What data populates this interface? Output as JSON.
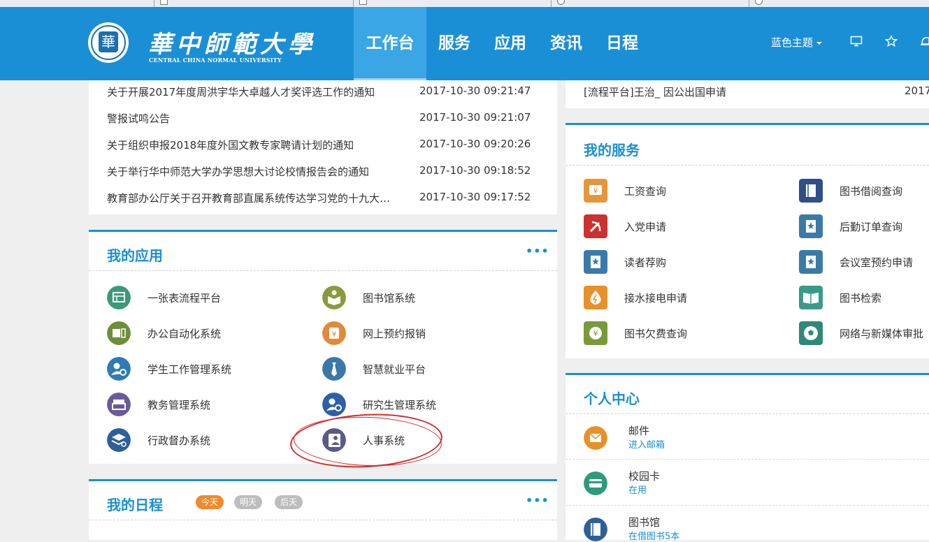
{
  "header": {
    "logo_cn": "華中師範大學",
    "logo_en": "CENTRAL CHINA NORMAL UNIVERSITY",
    "seal_char": "華",
    "nav": [
      {
        "label": "工作台",
        "active": true
      },
      {
        "label": "服务",
        "active": false
      },
      {
        "label": "应用",
        "active": false
      },
      {
        "label": "资讯",
        "active": false
      },
      {
        "label": "日程",
        "active": false
      }
    ],
    "theme_label": "蓝色主题",
    "icons": [
      "monitor-icon",
      "star-icon",
      "bell-icon"
    ]
  },
  "news": [
    {
      "title": "关于开展2017年度周洪宇华大卓越人才奖评选工作的通知",
      "date": "2017-10-30 09:21:47"
    },
    {
      "title": "警报试鸣公告",
      "date": "2017-10-30 09:21:07"
    },
    {
      "title": "关于组织申报2018年度外国文教专家聘请计划的通知",
      "date": "2017-10-30 09:20:26"
    },
    {
      "title": "关于举行华中师范大学办学思想大讨论校情报告会的通知",
      "date": "2017-10-30 09:18:52"
    },
    {
      "title": "教育部办公厅关于召开教育部直属系统传达学习党的十九大…",
      "date": "2017-10-30 09:17:52"
    }
  ],
  "workflow": {
    "title": "[流程平台]王治_ 因公出国申请",
    "date": "2017"
  },
  "my_apps": {
    "title": "我的应用",
    "more": "•••",
    "items": [
      {
        "label": "一张表流程平台",
        "icon": "table-icon",
        "color": "#3a9a78"
      },
      {
        "label": "图书馆系统",
        "icon": "book-reader-icon",
        "color": "#8a9a3a"
      },
      {
        "label": "办公自动化系统",
        "icon": "oa-icon",
        "color": "#6f8d3a"
      },
      {
        "label": "网上预约报销",
        "icon": "yuan-receipt-icon",
        "color": "#e08a3a"
      },
      {
        "label": "学生工作管理系统",
        "icon": "user-gear-icon",
        "color": "#2e7bb6"
      },
      {
        "label": "智慧就业平台",
        "icon": "tie-icon",
        "color": "#3a78a8"
      },
      {
        "label": "教务管理系统",
        "icon": "inbox-icon",
        "color": "#6a5a9a"
      },
      {
        "label": "研究生管理系统",
        "icon": "user-gear-icon",
        "color": "#2e5fa8"
      },
      {
        "label": "行政督办系统",
        "icon": "layers-icon",
        "color": "#2e5f9a"
      },
      {
        "label": "人事系统",
        "icon": "person-card-icon",
        "color": "#5a5a8a"
      }
    ]
  },
  "my_services": {
    "title": "我的服务",
    "items": [
      {
        "label": "工资查询",
        "icon": "yuan-card-icon",
        "color": "#e6963a"
      },
      {
        "label": "图书借阅查询",
        "icon": "book-icon",
        "color": "#2e4f8a"
      },
      {
        "label": "入党申请",
        "icon": "party-icon",
        "color": "#cc3030"
      },
      {
        "label": "后勤订单查询",
        "icon": "star-doc-icon",
        "color": "#3a7aa8"
      },
      {
        "label": "读者荐购",
        "icon": "star-doc-icon",
        "color": "#3a7aa8"
      },
      {
        "label": "会议室预约申请",
        "icon": "star-doc-icon",
        "color": "#3a7aa8"
      },
      {
        "label": "接水接电申请",
        "icon": "power-drop-icon",
        "color": "#e8902a"
      },
      {
        "label": "图书检索",
        "icon": "open-book-icon",
        "color": "#3a9a88"
      },
      {
        "label": "图书欠费查询",
        "icon": "yuan-leaf-icon",
        "color": "#7a9a3a"
      },
      {
        "label": "网络与新媒体审批",
        "icon": "football-icon",
        "color": "#2e8a78"
      }
    ]
  },
  "personal_center": {
    "title": "个人中心",
    "items": [
      {
        "name": "邮件",
        "sub": "进入邮箱",
        "icon": "mail-icon",
        "color": "#e8902a"
      },
      {
        "name": "校园卡",
        "sub": "在用",
        "icon": "card-icon",
        "color": "#2e9a7a"
      },
      {
        "name": "图书馆",
        "sub": "在借图书5本",
        "icon": "book-icon",
        "color": "#2e5f9a"
      }
    ]
  },
  "my_schedule": {
    "title": "我的日程",
    "more": "•••",
    "tabs": [
      {
        "label": "今天",
        "color": "#f08a2a"
      },
      {
        "label": "明天",
        "color": "#bdbdbd"
      },
      {
        "label": "后天",
        "color": "#bdbdbd"
      }
    ]
  }
}
